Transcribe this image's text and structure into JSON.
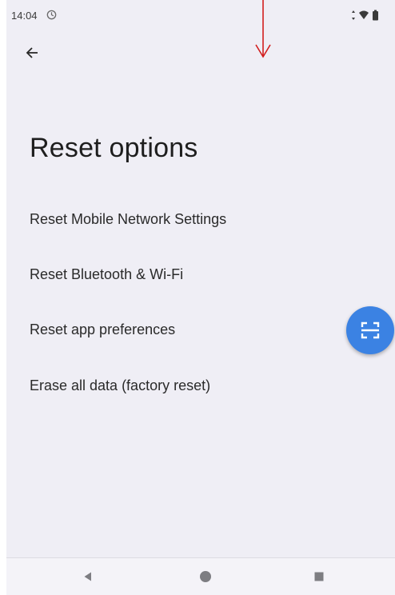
{
  "status_bar": {
    "time": "14:04",
    "icons": [
      "sync-icon",
      "signal-icon",
      "wifi-icon",
      "battery-icon"
    ]
  },
  "header": {
    "back_icon": "arrow-left-icon",
    "title": "Reset options"
  },
  "menu": {
    "items": [
      {
        "label": "Reset Mobile Network Settings"
      },
      {
        "label": "Reset Bluetooth & Wi-Fi"
      },
      {
        "label": "Reset app preferences"
      },
      {
        "label": "Erase all data (factory reset)"
      }
    ]
  },
  "fab": {
    "icon": "scan-icon",
    "color": "#3b82e3"
  },
  "nav_bar": {
    "buttons": [
      "back-triangle-icon",
      "home-circle-icon",
      "recents-square-icon"
    ]
  },
  "annotation": {
    "icon": "down-arrow-indicator",
    "color": "#d21e1e"
  }
}
